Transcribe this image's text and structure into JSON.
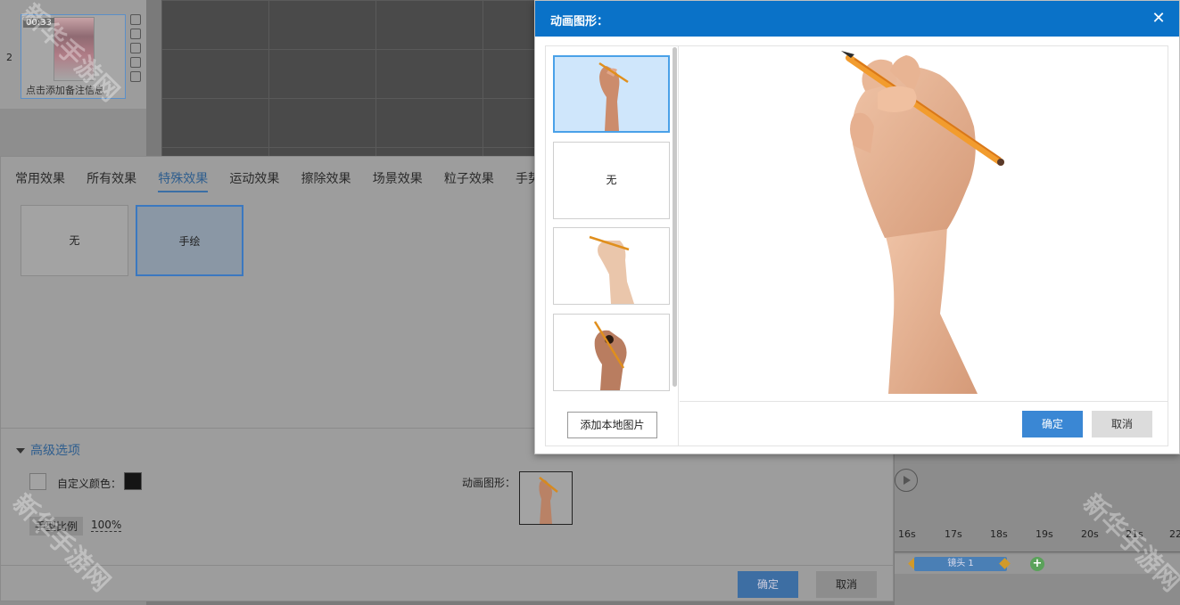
{
  "slide_panel": {
    "slide_number": "2",
    "time": "00:33",
    "note_placeholder": "点击添加备注信息"
  },
  "effect_dialog": {
    "tabs": [
      "常用效果",
      "所有效果",
      "特殊效果",
      "运动效果",
      "擦除效果",
      "场景效果",
      "粒子效果",
      "手势"
    ],
    "active_tab": "特殊效果",
    "effects": [
      "无",
      "手绘"
    ],
    "selected_effect": "手绘",
    "advanced": {
      "header": "高级选项",
      "custom_color_label": "自定义颜色：",
      "custom_color": "#151515",
      "anim_shape_label": "动画图形：",
      "hand_scale_label": "手型比例",
      "hand_scale_value": "100%"
    },
    "ok_label": "确定",
    "cancel_label": "取消"
  },
  "timeline": {
    "ticks": [
      "16s",
      "17s",
      "18s",
      "19s",
      "20s",
      "21s",
      "22"
    ],
    "clip_label": "镜头 1"
  },
  "watermark": "新华手游网",
  "anim_modal": {
    "title": "动画图形：",
    "close_icon": "close-icon",
    "items": [
      {
        "type": "image",
        "name": "hand-pencil-1"
      },
      {
        "type": "none",
        "label": "无"
      },
      {
        "type": "image",
        "name": "hand-pencil-2"
      },
      {
        "type": "image",
        "name": "hand-pencil-3"
      }
    ],
    "selected_index": 0,
    "add_local_label": "添加本地图片",
    "ok_label": "确定",
    "cancel_label": "取消"
  },
  "colors": {
    "modal_header": "#0a72c8",
    "selection_border": "#4aa1e8",
    "ok_button": "#3a87d4",
    "pencil": "#f0a030",
    "skin": "#e3b08f"
  }
}
